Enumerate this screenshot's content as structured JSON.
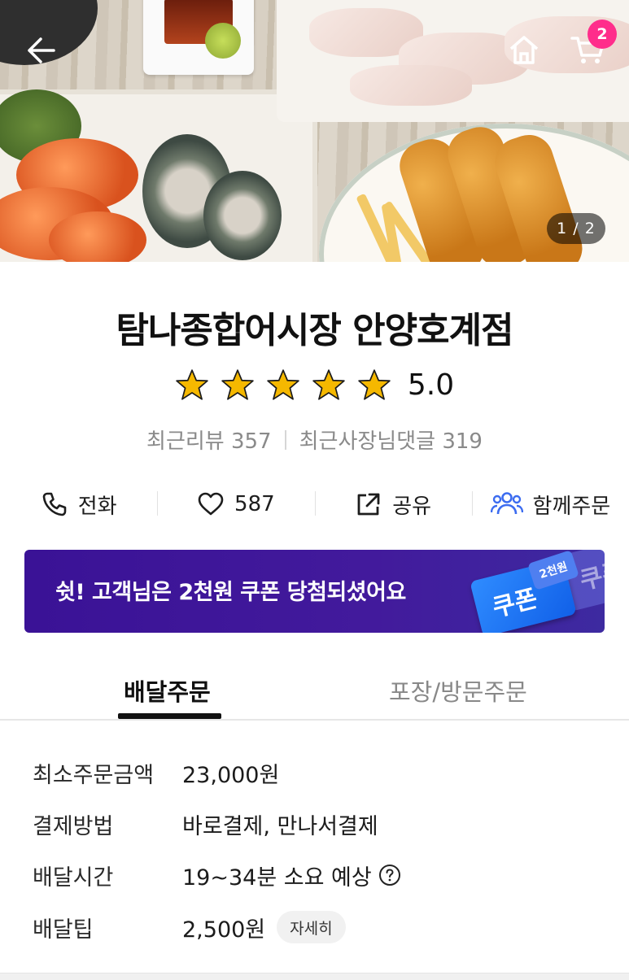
{
  "hero": {
    "pager_text": "1 / 2",
    "cart_count": "2"
  },
  "store": {
    "name": "탐나종합어시장 안양호계점",
    "rating": "5.0",
    "stars": 5,
    "recent_reviews": "최근리뷰 357",
    "owner_replies": "최근사장님댓글 319"
  },
  "actions": {
    "call": "전화",
    "likes": "587",
    "share": "공유",
    "group_order": "함께주문"
  },
  "banner": {
    "text": "쉿! 고객님은 2천원 쿠폰 당첨되셨어요",
    "coupon_label": "쿠폰",
    "coupon_tag": "2천원",
    "coupon_echo": "쿠폰"
  },
  "tabs": {
    "delivery": "배달주문",
    "pickup": "포장/방문주문"
  },
  "info": {
    "min_order_label": "최소주문금액",
    "min_order_value": "23,000원",
    "payment_label": "결제방법",
    "payment_value": "바로결제, 만나서결제",
    "delivery_time_label": "배달시간",
    "delivery_time_value": "19~34분 소요 예상",
    "delivery_tip_label": "배달팁",
    "delivery_tip_value": "2,500원",
    "detail_button": "자세히"
  },
  "colors": {
    "accent_purple": "#3a1296",
    "badge_pink": "#ff2d8b",
    "group_order_blue": "#3c6cf0",
    "star_gold": "#f5b800"
  }
}
